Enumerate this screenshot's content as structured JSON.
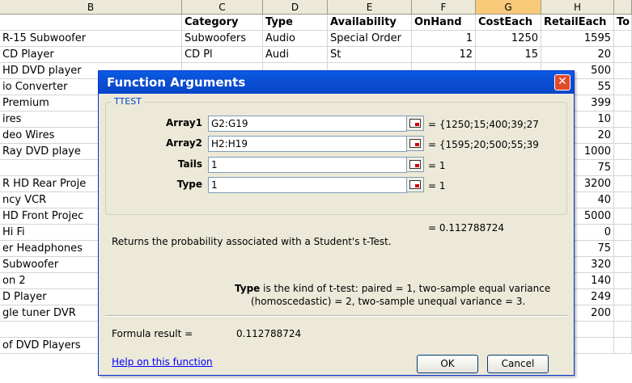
{
  "columns": [
    {
      "label": "B"
    },
    {
      "label": "C"
    },
    {
      "label": "D"
    },
    {
      "label": "E"
    },
    {
      "label": "F"
    },
    {
      "label": "G"
    },
    {
      "label": "H"
    },
    {
      "label": ""
    }
  ],
  "header_row": [
    "",
    "Category",
    "Type",
    "Availability",
    "OnHand",
    "CostEach",
    "RetailEach",
    "To"
  ],
  "rows": [
    {
      "b": "R-15 Subwoofer",
      "c": "Subwoofers",
      "d": "Audio",
      "e": "Special Order",
      "f": "1",
      "g": "1250",
      "h": "1595"
    },
    {
      "b": "CD Player",
      "c": "CD Pl",
      "d": "Audi",
      "e": "St",
      "f": "12",
      "g": "15",
      "h": "20"
    },
    {
      "b": "HD DVD player",
      "h": "500"
    },
    {
      "b": "io Converter",
      "h": "55"
    },
    {
      "b": "Premium",
      "h": "399"
    },
    {
      "b": "ires",
      "h": "10"
    },
    {
      "b": "deo Wires",
      "h": "20"
    },
    {
      "b": "Ray DVD playe",
      "h": "1000"
    },
    {
      "b": "",
      "h": "75"
    },
    {
      "b": "R HD Rear Proje",
      "h": "3200"
    },
    {
      "b": "ncy VCR",
      "h": "40"
    },
    {
      "b": "HD Front Projec",
      "h": "5000"
    },
    {
      "b": "Hi Fi",
      "h": "0"
    },
    {
      "b": "er Headphones",
      "h": "75"
    },
    {
      "b": "Subwoofer",
      "h": "320"
    },
    {
      "b": "on 2",
      "h": "140"
    },
    {
      "b": "D Player",
      "h": "249"
    },
    {
      "b": "gle tuner DVR",
      "h": "200"
    },
    {
      "b": "",
      "h": ""
    },
    {
      "b": "of DVD Players",
      "h": ""
    }
  ],
  "dialog": {
    "title": "Function Arguments",
    "close_icon": "close-icon",
    "function_name": "TTEST",
    "args": [
      {
        "label": "Array1",
        "value": "G2:G19",
        "result": "= {1250;15;400;39;27"
      },
      {
        "label": "Array2",
        "value": "H2:H19",
        "result": "= {1595;20;500;55;39"
      },
      {
        "label": "Tails",
        "value": "1",
        "result": "= 1"
      },
      {
        "label": "Type",
        "value": "1",
        "result": "= 1"
      }
    ],
    "function_result": "= 0.112788724",
    "description": "Returns the probability associated with a Student's t-Test.",
    "arg_help_bold": "Type",
    "arg_help_text": "is the kind of t-test: paired = 1, two-sample equal variance",
    "arg_help_text2": "(homoscedastic) = 2, two-sample unequal variance = 3.",
    "formula_result_label": "Formula result =",
    "formula_result_value": "0.112788724",
    "help_link": "Help on this function",
    "ok_label": "OK",
    "cancel_label": "Cancel"
  }
}
